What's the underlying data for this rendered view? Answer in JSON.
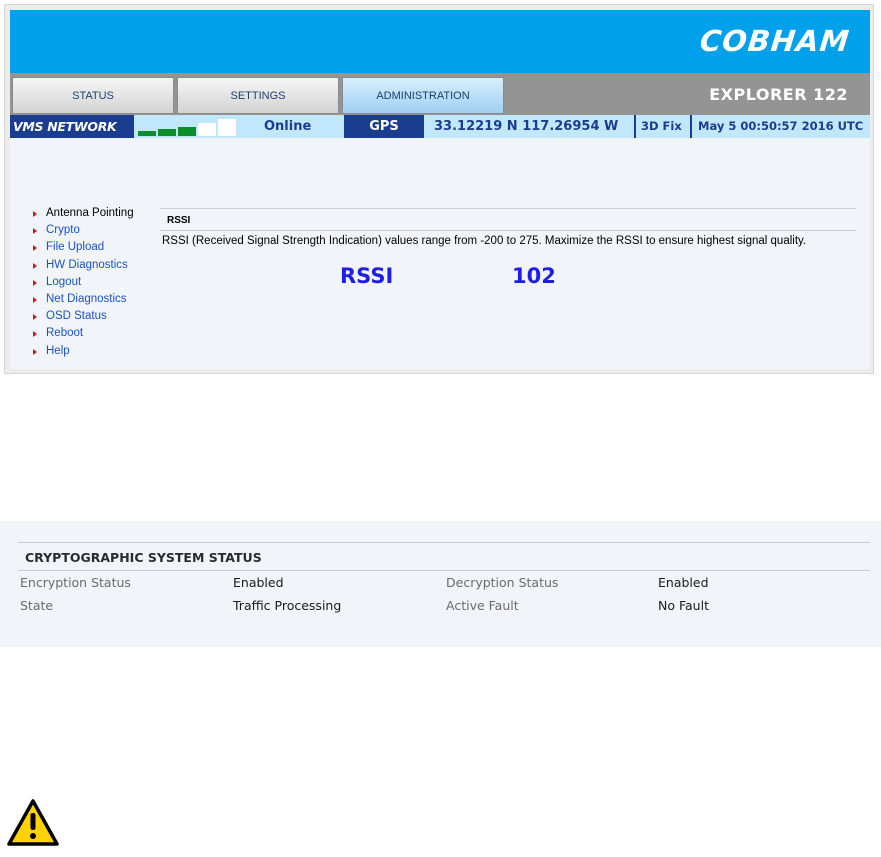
{
  "banner": {
    "brand": "COBHAM",
    "product": "EXPLORER 122",
    "color": "#00a0ea"
  },
  "tabs": [
    {
      "label": "STATUS",
      "active": false
    },
    {
      "label": "SETTINGS",
      "active": false
    },
    {
      "label": "ADMINISTRATION",
      "active": true
    }
  ],
  "status_bar": {
    "network": "VMS NETWORK",
    "signal_bars_on": 3,
    "signal_bars_total": 5,
    "connection": "Online",
    "gps_label": "GPS",
    "coordinates": "33.12219 N 117.26954 W",
    "fix": "3D Fix",
    "datetime": "May 5 00:50:57 2016 UTC"
  },
  "menu": [
    {
      "label": "Antenna Pointing",
      "current": true
    },
    {
      "label": "Crypto",
      "current": false
    },
    {
      "label": "File Upload",
      "current": false
    },
    {
      "label": "HW Diagnostics",
      "current": false
    },
    {
      "label": "Logout",
      "current": false
    },
    {
      "label": "Net Diagnostics",
      "current": false
    },
    {
      "label": "OSD Status",
      "current": false
    },
    {
      "label": "Reboot",
      "current": false
    },
    {
      "label": "Help",
      "current": false
    }
  ],
  "rssi": {
    "title": "RSSI",
    "description": "RSSI (Received Signal Strength Indication) values range from -200 to 275. Maximize the RSSI to ensure highest signal quality.",
    "label": "RSSI",
    "value": "102"
  },
  "crypto_status": {
    "title": "CRYPTOGRAPHIC SYSTEM STATUS",
    "rows": [
      {
        "label1": "Encryption Status",
        "value1": "Enabled",
        "label2": "Decryption Status",
        "value2": "Enabled"
      },
      {
        "label1": "State",
        "value1": "Traffic Processing",
        "label2": "Active Fault",
        "value2": "No Fault"
      }
    ]
  },
  "icons": {
    "warning": "warning-triangle-icon"
  }
}
